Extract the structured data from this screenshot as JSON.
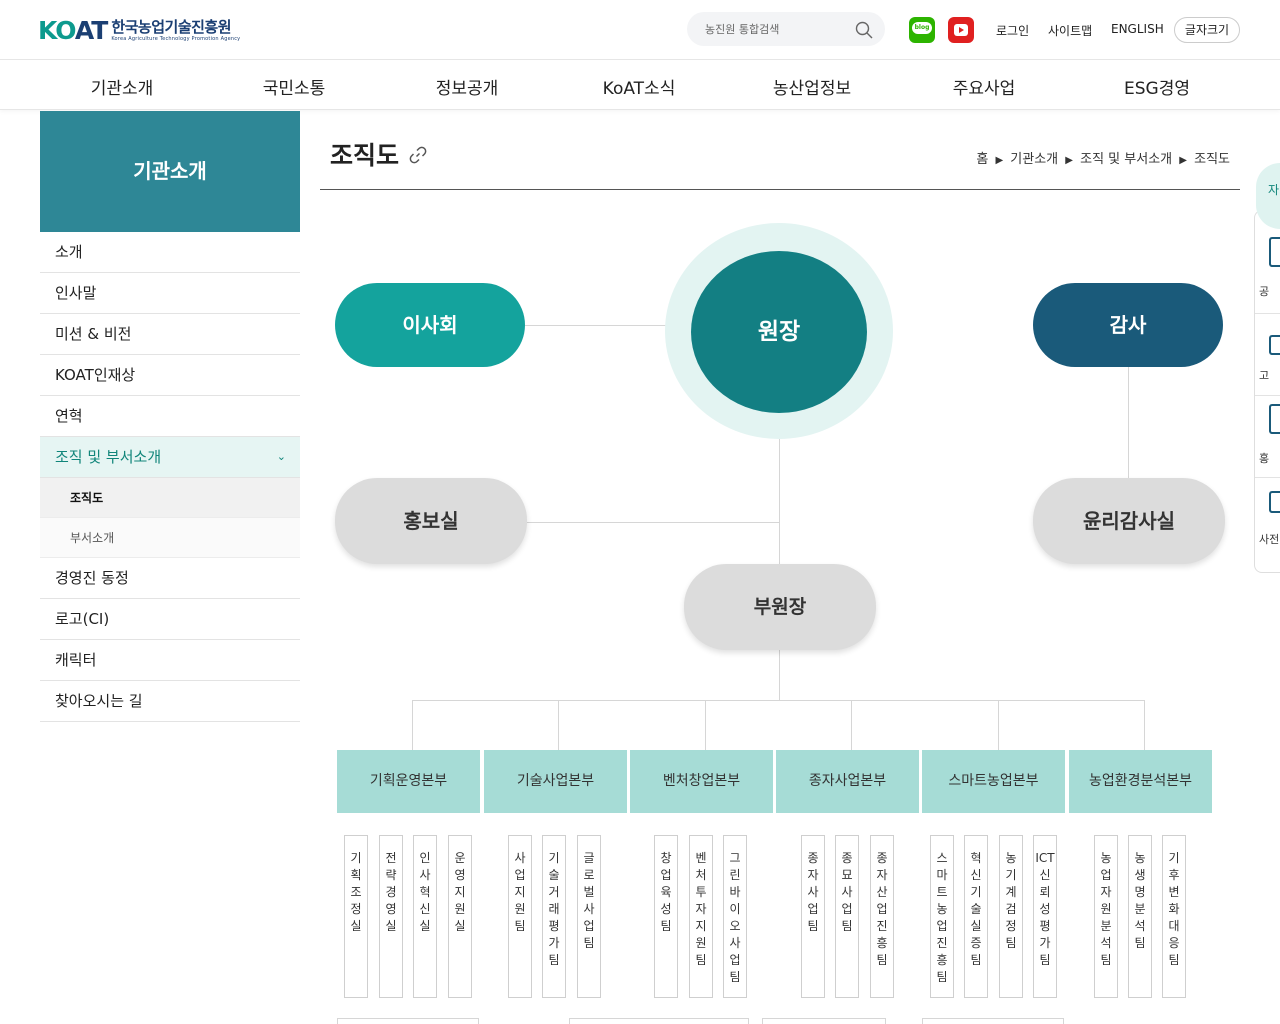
{
  "header": {
    "logo_mark": "KOAT",
    "logo_ko": "한국농업기술진흥원",
    "logo_en": "Korea Agriculture Technology Promotion Agency",
    "search_placeholder": "농진원 통합검색",
    "blog_label": "blog",
    "login": "로그인",
    "sitemap": "사이트맵",
    "english": "ENGLISH",
    "font_size": "글자크기"
  },
  "gnb": [
    "기관소개",
    "국민소통",
    "정보공개",
    "KoAT소식",
    "농산업정보",
    "주요사업",
    "ESG경영"
  ],
  "lnb": {
    "title": "기관소개",
    "items": [
      {
        "label": "소개"
      },
      {
        "label": "인사말"
      },
      {
        "label": "미션 & 비전"
      },
      {
        "label": "KOAT인재상"
      },
      {
        "label": "연혁"
      },
      {
        "label": "조직 및 부서소개"
      },
      {
        "label": "경영진 동정"
      },
      {
        "label": "로고(CI)"
      },
      {
        "label": "캐릭터"
      },
      {
        "label": "찾아오시는 길"
      }
    ],
    "sub_items": [
      "조직도",
      "부서소개"
    ]
  },
  "page": {
    "title": "조직도",
    "breadcrumb": [
      "홈",
      "기관소개",
      "조직 및 부서소개",
      "조직도"
    ]
  },
  "org": {
    "board": "이사회",
    "ceo": "원장",
    "audit": "감사",
    "pr": "홍보실",
    "ethics": "윤리감사실",
    "vp": "부원장",
    "divisions": [
      {
        "name": "기획운영본부",
        "teams": [
          "기획조정실",
          "전략경영실",
          "인사혁신실",
          "운영지원실"
        ]
      },
      {
        "name": "기술사업본부",
        "teams": [
          "사업지원팀",
          "기술거래평가팀",
          "글로벌사업팀"
        ]
      },
      {
        "name": "벤처창업본부",
        "teams": [
          "창업육성팀",
          "벤처투자지원팀",
          "그린바이오사업팀"
        ]
      },
      {
        "name": "종자사업본부",
        "teams": [
          "종자사업팀",
          "종묘사업팀",
          "종자산업진흥팀"
        ]
      },
      {
        "name": "스마트농업본부",
        "teams": [
          "스마트농업진흥팀",
          "혁신기술실증팀",
          "농기계검정팀",
          "ICT신뢰성평가팀"
        ]
      },
      {
        "name": "농업환경분석본부",
        "teams": [
          "농업자원분석팀",
          "농생명분석팀",
          "기후변화대응팀"
        ]
      }
    ]
  },
  "quick_menu": {
    "top": "자",
    "items": [
      "공",
      "고",
      "홍",
      "사전"
    ]
  },
  "colors": {
    "teal_header": "#2e8796",
    "board": "#14a39d",
    "ceo": "#137f83",
    "audit": "#1a5a7a",
    "division": "#a6dcd6"
  }
}
